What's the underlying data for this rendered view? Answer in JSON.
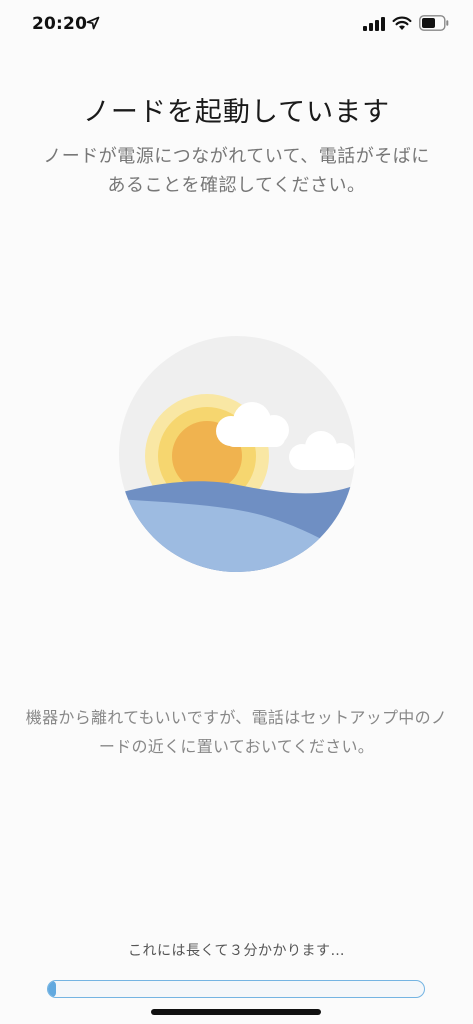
{
  "status_bar": {
    "time": "20:20",
    "location_icon": "location-arrow-icon",
    "signal_icon": "cellular-signal-icon",
    "wifi_icon": "wifi-icon",
    "battery_icon": "battery-icon"
  },
  "main": {
    "title": "ノードを起動しています",
    "subtitle": "ノードが電源につながれていて、電話がそばにあることを確認してください。",
    "illustration_icon": "sunrise-landscape-illustration",
    "note": "機器から離れてもいいですが、電話はセットアップ中のノードの近くに置いておいてください。",
    "wait_text": "これには長くて３分かかります…",
    "progress_percent": 1
  },
  "colors": {
    "background": "#fbfbfb",
    "progress_accent": "#62a9df",
    "sun": "#f2b64c",
    "wave_dark": "#6f8fc3",
    "wave_light": "#9dbbe1"
  }
}
